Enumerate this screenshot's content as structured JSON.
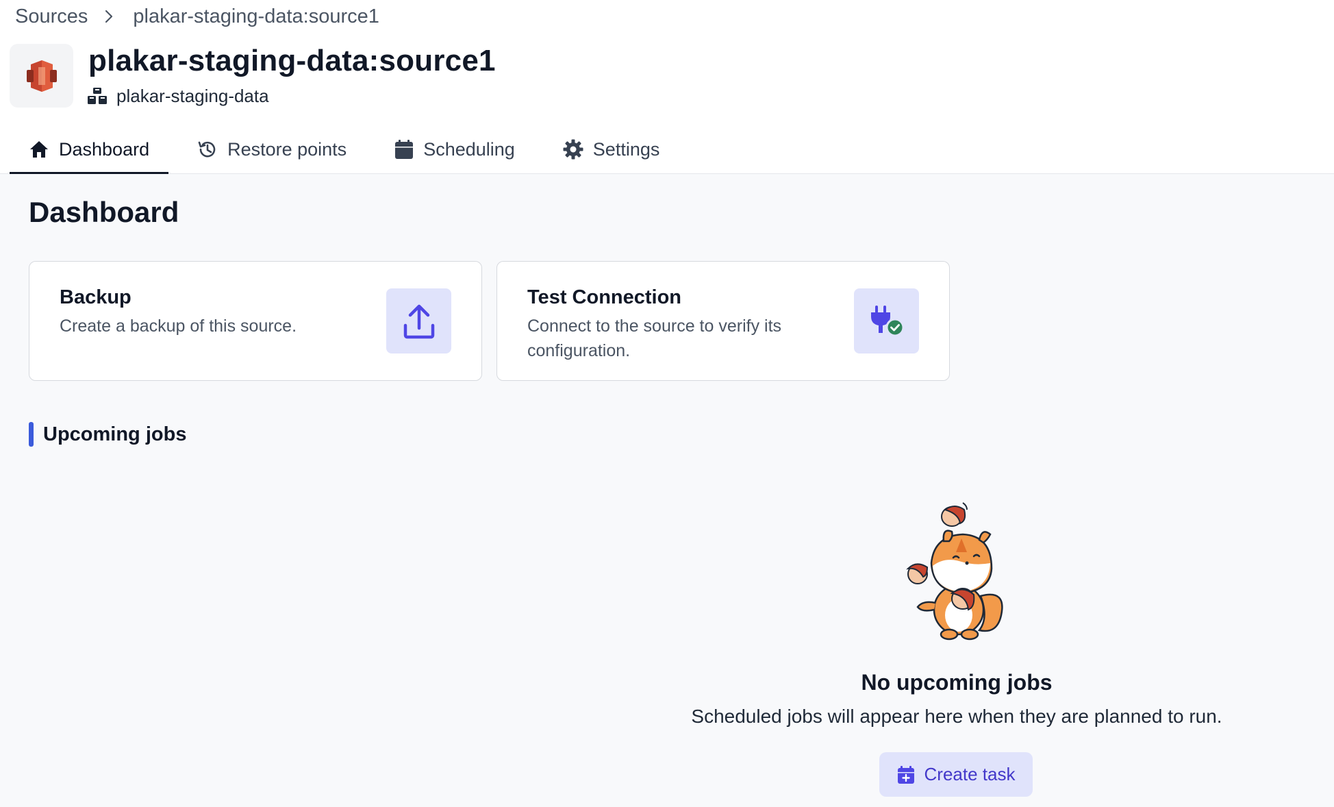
{
  "breadcrumb": {
    "root": "Sources",
    "current": "plakar-staging-data:source1"
  },
  "source": {
    "title": "plakar-staging-data:source1",
    "bucket": "plakar-staging-data",
    "icon": "aws-s3-icon"
  },
  "tabs": [
    {
      "label": "Dashboard",
      "icon": "home-icon",
      "active": true
    },
    {
      "label": "Restore points",
      "icon": "history-icon",
      "active": false
    },
    {
      "label": "Scheduling",
      "icon": "calendar-icon",
      "active": false
    },
    {
      "label": "Settings",
      "icon": "gear-icon",
      "active": false
    }
  ],
  "page_title": "Dashboard",
  "cards": [
    {
      "title": "Backup",
      "description": "Create a backup of this source.",
      "icon": "upload-icon"
    },
    {
      "title": "Test Connection",
      "description": "Connect to the source to verify its configuration.",
      "icon": "plug-check-icon"
    }
  ],
  "upcoming": {
    "heading": "Upcoming jobs",
    "empty_title": "No upcoming jobs",
    "empty_description": "Scheduled jobs will appear here when they are planned to run.",
    "button_label": "Create task",
    "button_icon": "calendar-plus-icon"
  },
  "colors": {
    "accent": "#3b5bdb",
    "button_bg": "#e0e3fb",
    "button_text": "#4338ca",
    "s3_red": "#c7452f",
    "check_green": "#2f855a"
  }
}
